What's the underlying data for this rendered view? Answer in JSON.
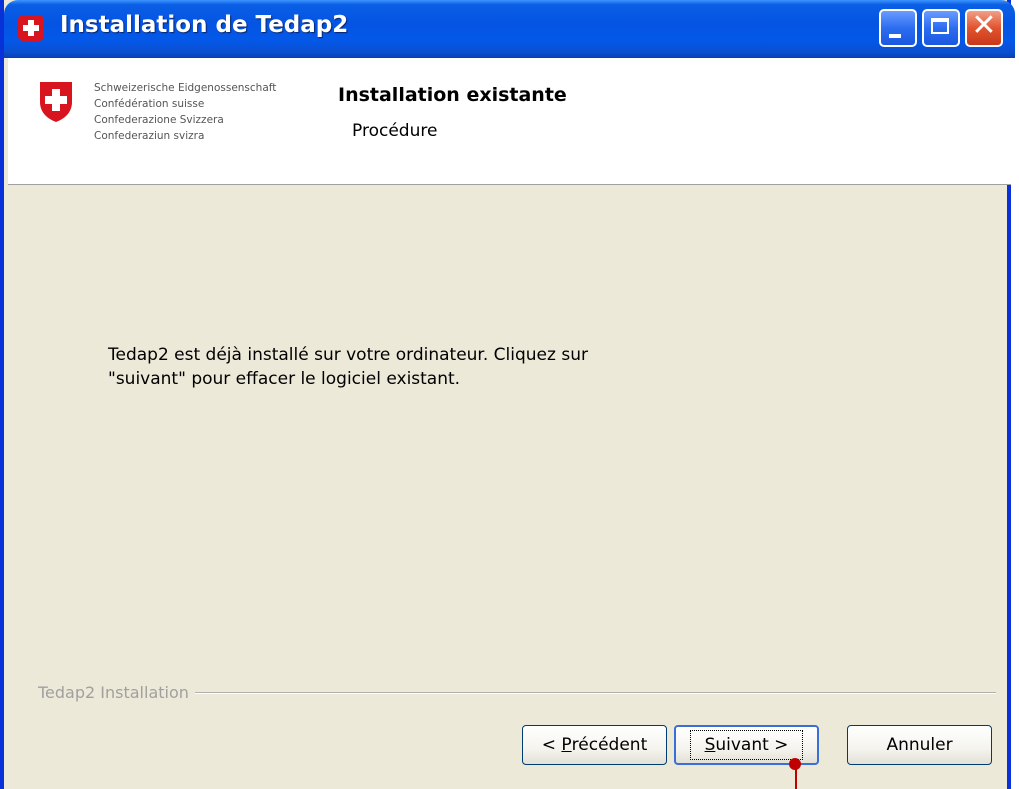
{
  "window": {
    "title": "Installation de Tedap2",
    "controls": {
      "minimize": "minimize",
      "maximize": "maximize",
      "close": "✕"
    }
  },
  "banner": {
    "org_names": [
      "Schweizerische Eidgenossenschaft",
      "Confédération suisse",
      "Confederazione Svizzera",
      "Confederaziun svizra"
    ],
    "title": "Installation existante",
    "subtitle": "Procédure"
  },
  "content": {
    "message_line1": "Tedap2 est déjà installé sur votre ordinateur. Cliquez sur",
    "message_line2": "\"suivant\" pour effacer le logiciel existant."
  },
  "footer": {
    "group_label": "Tedap2 Installation",
    "buttons": {
      "previous_prefix": "< ",
      "previous_accel": "P",
      "previous_rest": "récédent",
      "next_accel": "S",
      "next_rest": "uivant >",
      "cancel": "Annuler"
    }
  },
  "colors": {
    "title_bar": "#0554e3",
    "window_bg": "#ece9d8",
    "swiss_red": "#d8141f",
    "close_button": "#e2532f",
    "pointer": "#c00000"
  }
}
